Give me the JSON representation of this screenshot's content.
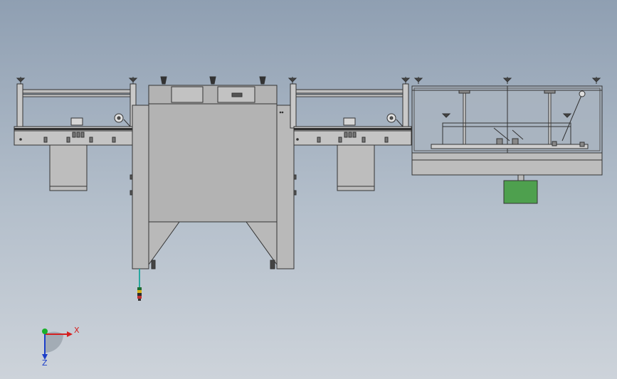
{
  "triad": {
    "x_label": "X",
    "z_label": "Z",
    "colors": {
      "x": "#d42020",
      "y": "#19b02b",
      "z": "#1c3fc9"
    }
  },
  "palette": {
    "background_top": "#8f9fb2",
    "background_bottom": "#cdd3da",
    "body_gray": "#b8b8b8",
    "outline": "#333333",
    "glass": "#a9b4c0",
    "motor_green": "#4ea04e"
  },
  "icons": [
    "leveling-foot-icon",
    "sensor-stack-icon",
    "axis-triad-icon"
  ]
}
